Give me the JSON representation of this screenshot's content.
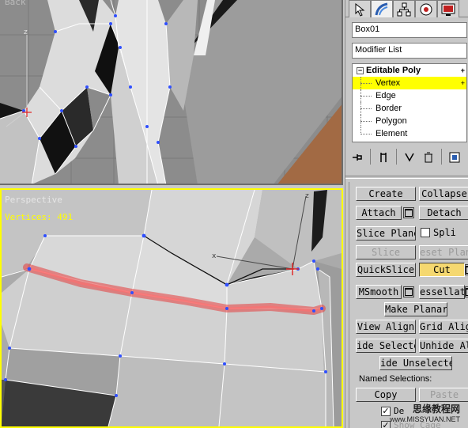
{
  "viewports": {
    "top": {
      "label": "Back"
    },
    "perspective": {
      "label": "Perspective",
      "vertex_count": "Vertices: 491"
    }
  },
  "command_panel": {
    "tabs": [
      "create-icon",
      "modify-icon",
      "hierarchy-icon",
      "motion-icon",
      "display-icon"
    ],
    "object_name": "Box01",
    "modifier_list": "Modifier List",
    "stack": {
      "base": "Editable Poly",
      "levels": [
        "Vertex",
        "Edge",
        "Border",
        "Polygon",
        "Element"
      ],
      "selected": "Vertex"
    },
    "edit_geometry": {
      "create": "Create",
      "collapse": "Collapse",
      "attach": "Attach",
      "detach": "Detach",
      "slice_plane": "Slice Plane",
      "split": "Spli",
      "slice": "Slice",
      "reset_plane": "eset Plan",
      "quickslice": "QuickSlice",
      "cut": "Cut",
      "msmooth": "MSmooth",
      "tessellate": "essellat",
      "make_planar": "Make Planar",
      "view_align": "View Align",
      "grid_align": "Grid Align",
      "hide_selected": "ide Selecte",
      "unhide_all": "Unhide All",
      "hide_unselected": "ide Unselecte",
      "named_selections": "Named Selections:",
      "copy": "Copy",
      "paste": "Paste",
      "delete_isolated": "De",
      "show_cage": "Show Cage"
    }
  },
  "watermark": {
    "line1": "思缘教程网",
    "line2": "www.MISSYUAN.NET"
  }
}
